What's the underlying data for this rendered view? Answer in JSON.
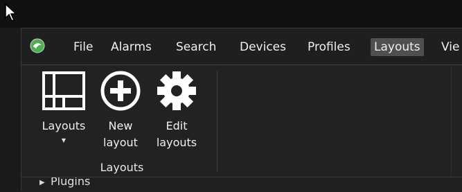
{
  "menu": {
    "items": [
      {
        "label": "File"
      },
      {
        "label": "Alarms"
      },
      {
        "label": "Search"
      },
      {
        "label": "Devices"
      },
      {
        "label": "Profiles"
      },
      {
        "label": "Layouts",
        "active": true
      },
      {
        "label": "Vie"
      }
    ]
  },
  "ribbon": {
    "buttons": [
      {
        "label": "Layouts",
        "icon": "layout-grid-icon",
        "has_dropdown": true
      },
      {
        "label": "New\nlayout",
        "icon": "plus-circle-icon"
      },
      {
        "label": "Edit\nlayouts",
        "icon": "gear-icon"
      }
    ],
    "group_label": "Layouts"
  },
  "panel": {
    "plugins_label": "Plugins"
  },
  "colors": {
    "background": "#222222",
    "active_menu": "#4f4f4f",
    "logo_green": "#4caf50"
  }
}
